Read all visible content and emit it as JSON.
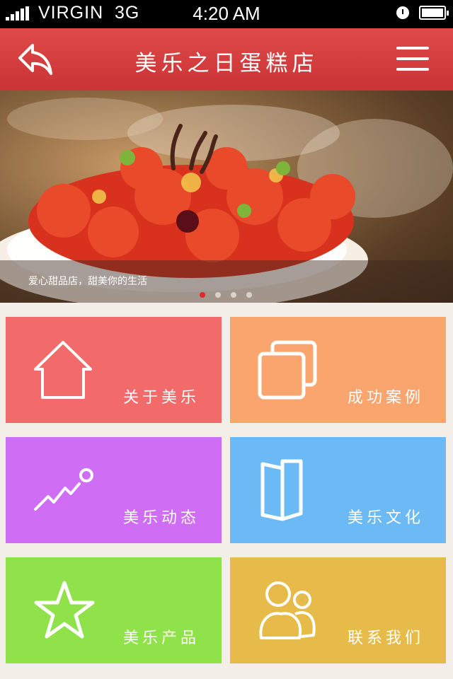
{
  "status_bar": {
    "carrier": "VIRGIN",
    "network": "3G",
    "time": "4:20 AM"
  },
  "nav": {
    "title": "美乐之日蛋糕店",
    "back_icon": "back-arrow-icon",
    "menu_icon": "hamburger-menu-icon",
    "color": "#d63d3f"
  },
  "banner": {
    "caption": "爱心甜品店，甜美你的生活",
    "slide_count": 4,
    "active_slide": 1
  },
  "tiles": [
    {
      "label": "关于美乐",
      "icon": "home-icon",
      "color": "#f26b6a"
    },
    {
      "label": "成功案例",
      "icon": "gallery-icon",
      "color": "#f9a56d"
    },
    {
      "label": "美乐动态",
      "icon": "trend-icon",
      "color": "#cf6ef4"
    },
    {
      "label": "美乐文化",
      "icon": "book-icon",
      "color": "#6bbaf6"
    },
    {
      "label": "美乐产品",
      "icon": "star-icon",
      "color": "#8fe249"
    },
    {
      "label": "联系我们",
      "icon": "users-icon",
      "color": "#e6bb49"
    }
  ]
}
